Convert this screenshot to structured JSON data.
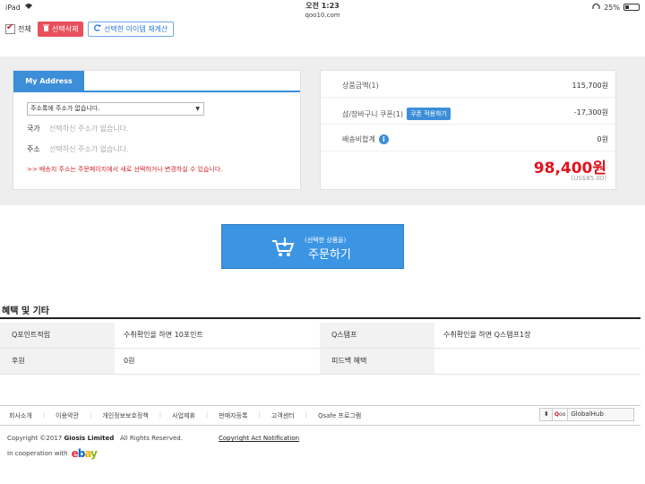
{
  "statusbar": {
    "device": "iPad",
    "time": "오전 1:23",
    "url": "qoo10.com",
    "battery": "25%"
  },
  "cart_toolbar": {
    "select_all_label": "전체",
    "delete_label": "선택삭제",
    "recalc_label": "선택한 아이템 재계산"
  },
  "address": {
    "tab_label": "My Address",
    "select_value": "주소록에 주소가 없습니다.",
    "country_label": "국가",
    "country_value": "선택하신 주소가 없습니다.",
    "address_label": "주소",
    "address_value": "선택하신 주소가 없습니다.",
    "note": ">> 배송지 주소는 주문페이지에서 새로 선택하거나 변경하실 수 있습니다."
  },
  "summary": {
    "product_label": "상품금액(1)",
    "product_amount": "115,700원",
    "coupon_label": "샵/장바구니 쿠폰(1)",
    "coupon_button": "쿠폰 적용하기",
    "coupon_amount": "-17,300원",
    "shipping_label": "배송비합계",
    "shipping_amount": "0원",
    "total": "98,400원",
    "total_usd": "(US$85.00)"
  },
  "order_button": {
    "sub": "(선택한 상품을)",
    "main": "주문하기"
  },
  "benefits": {
    "title": "혜택 및 기타",
    "rows": [
      {
        "h1": "Q포인트적립",
        "v1": "수취확인을 하면 10포인트",
        "h2": "Q스탬프",
        "v2": "수취확인을 하면 Q스탬프1장"
      },
      {
        "h1": "후원",
        "v1": "0원",
        "h2": "피드백 혜택",
        "v2": ""
      }
    ]
  },
  "footer": {
    "links": [
      "회사소개",
      "이용약관",
      "개인정보보호정책",
      "사업제휴",
      "판매자등록",
      "고객센터",
      "Qsafe 프로그램"
    ],
    "globalhub_label": "GlobalHub",
    "copyright_prefix": "Copyright ©2017",
    "company": "Giosis Limited",
    "rights": "All Rights Reserved.",
    "copyright_notice": "Copyright Act Notification",
    "cooperation": "In cooperation with"
  }
}
